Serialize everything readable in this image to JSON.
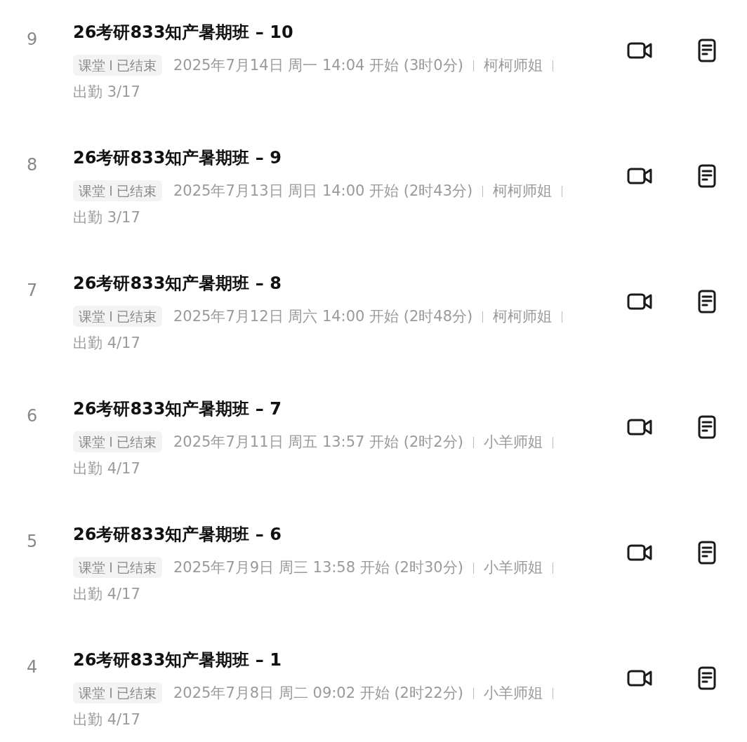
{
  "sessions": [
    {
      "index": "9",
      "title": "26考研833知产暑期班 – 10",
      "tag": {
        "type": "课堂",
        "status": "已结束"
      },
      "time": "2025年7月14日 周一 14:04 开始 (3时0分)",
      "teacher": "柯柯师姐",
      "attendance": "出勤 3/17"
    },
    {
      "index": "8",
      "title": "26考研833知产暑期班 – 9",
      "tag": {
        "type": "课堂",
        "status": "已结束"
      },
      "time": "2025年7月13日 周日 14:00 开始 (2时43分)",
      "teacher": "柯柯师姐",
      "attendance": "出勤 3/17"
    },
    {
      "index": "7",
      "title": "26考研833知产暑期班 – 8",
      "tag": {
        "type": "课堂",
        "status": "已结束"
      },
      "time": "2025年7月12日 周六 14:00 开始 (2时48分)",
      "teacher": "柯柯师姐",
      "attendance": "出勤 4/17"
    },
    {
      "index": "6",
      "title": "26考研833知产暑期班 – 7",
      "tag": {
        "type": "课堂",
        "status": "已结束"
      },
      "time": "2025年7月11日 周五 13:57 开始 (2时2分)",
      "teacher": "小羊师姐",
      "attendance": "出勤 4/17"
    },
    {
      "index": "5",
      "title": "26考研833知产暑期班 – 6",
      "tag": {
        "type": "课堂",
        "status": "已结束"
      },
      "time": "2025年7月9日 周三 13:58 开始 (2时30分)",
      "teacher": "小羊师姐",
      "attendance": "出勤 4/17"
    },
    {
      "index": "4",
      "title": "26考研833知产暑期班 – 1",
      "tag": {
        "type": "课堂",
        "status": "已结束"
      },
      "time": "2025年7月8日 周二 09:02 开始 (2时22分)",
      "teacher": "小羊师姐",
      "attendance": "出勤 4/17"
    }
  ]
}
